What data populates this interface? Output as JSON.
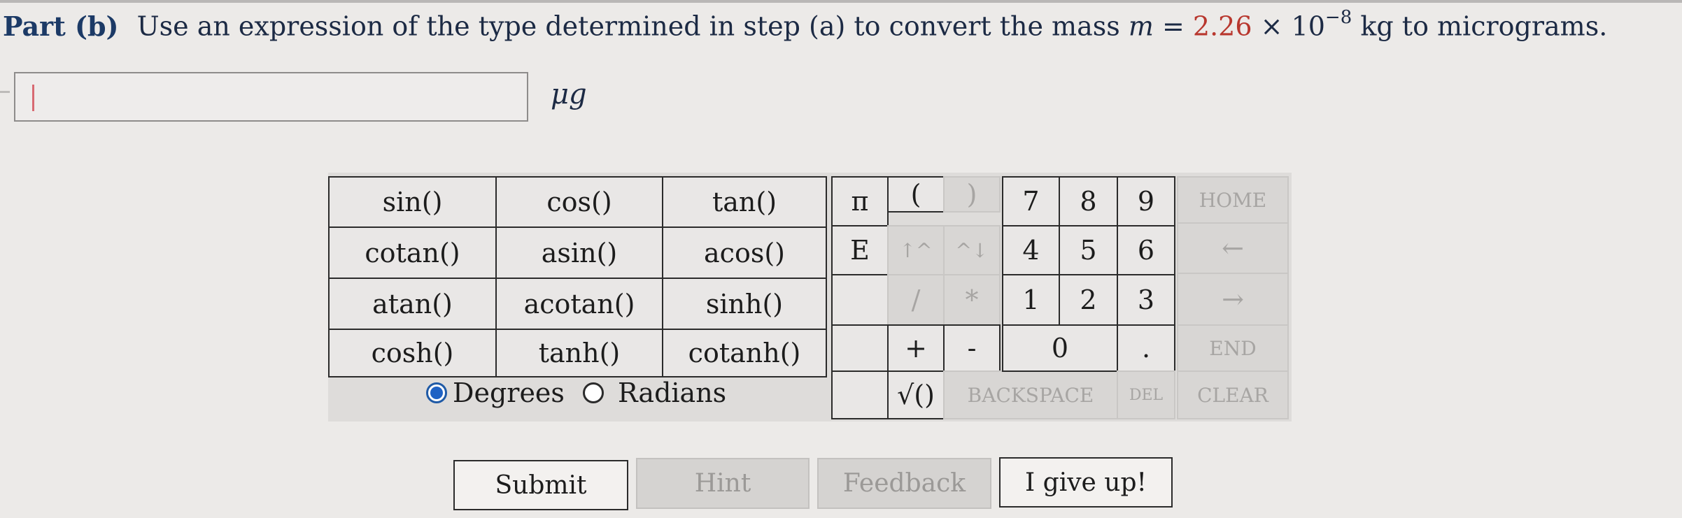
{
  "question": {
    "part_label": "Part (b)",
    "text_before": "Use an expression of the type determined in step (a) to convert the mass",
    "variable": "m",
    "equals": "=",
    "value_mantissa": "2.26",
    "times": "×",
    "base": "10",
    "exponent": "−8",
    "unit": "kg",
    "text_after": "to micrograms."
  },
  "answer": {
    "value": "",
    "unit": "μg"
  },
  "functions": [
    [
      "sin()",
      "cos()",
      "tan()"
    ],
    [
      "cotan()",
      "asin()",
      "acos()"
    ],
    [
      "atan()",
      "acotan()",
      "sinh()"
    ],
    [
      "cosh()",
      "tanh()",
      "cotanh()"
    ]
  ],
  "angle_mode": {
    "degrees_label": "Degrees",
    "radians_label": "Radians",
    "selected": "Degrees"
  },
  "keys": {
    "pi": "π",
    "e": "E",
    "open_paren": "(",
    "close_paren": ")",
    "up_arrows": "↑^",
    "down_arrows": "^↓",
    "divide": "/",
    "multiply": "*",
    "plus": "+",
    "minus": "-",
    "sqrt": "√()",
    "backspace": "BACKSPACE",
    "del": "DEL",
    "digits": [
      "7",
      "8",
      "9",
      "4",
      "5",
      "6",
      "1",
      "2",
      "3",
      "0",
      "."
    ],
    "home": "HOME",
    "left": "←",
    "right": "→",
    "end": "END",
    "clear": "CLEAR"
  },
  "buttons": {
    "submit": "Submit",
    "hint": "Hint",
    "feedback": "Feedback",
    "give_up": "I give up!"
  },
  "colors": {
    "value_red": "#b8372e",
    "radio_blue": "#1f62c4",
    "part_label": "#1c3a66"
  }
}
